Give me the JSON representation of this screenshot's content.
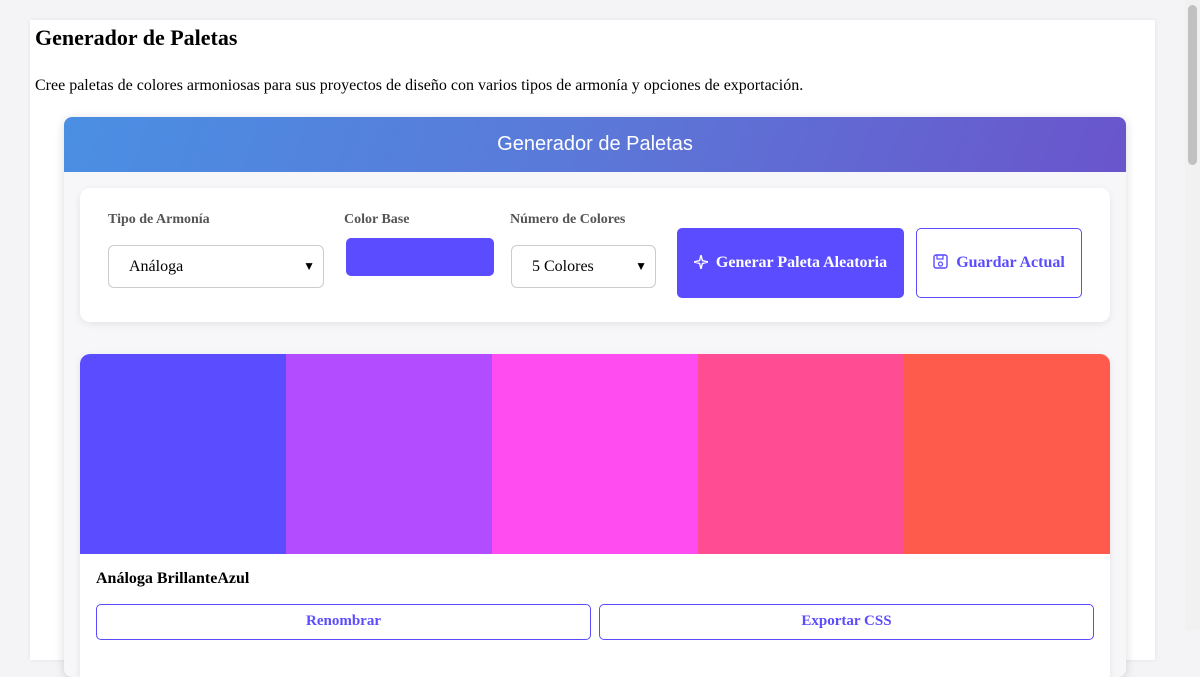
{
  "page": {
    "title": "Generador de Paletas",
    "description": "Cree paletas de colores armoniosas para sus proyectos de diseño con varios tipos de armonía y opciones de exportación."
  },
  "app": {
    "header_title": "Generador de Paletas",
    "controls": {
      "harmony_label": "Tipo de Armonía",
      "harmony_value": "Análoga",
      "base_color_label": "Color Base",
      "base_color": "#5b4cff",
      "count_label": "Número de Colores",
      "count_value": "5 Colores",
      "generate_label": "Generar Paleta Aleatoria",
      "generate_icon": "sparkle-icon",
      "save_label": "Guardar Actual",
      "save_icon": "floppy-disk-icon"
    },
    "palette": {
      "colors": [
        "#5b4cff",
        "#b34cff",
        "#ff4cf0",
        "#ff4c93",
        "#ff5b4c"
      ],
      "name": "Análoga BrillanteAzul",
      "rename_label": "Renombrar",
      "export_label": "Exportar CSS"
    }
  }
}
